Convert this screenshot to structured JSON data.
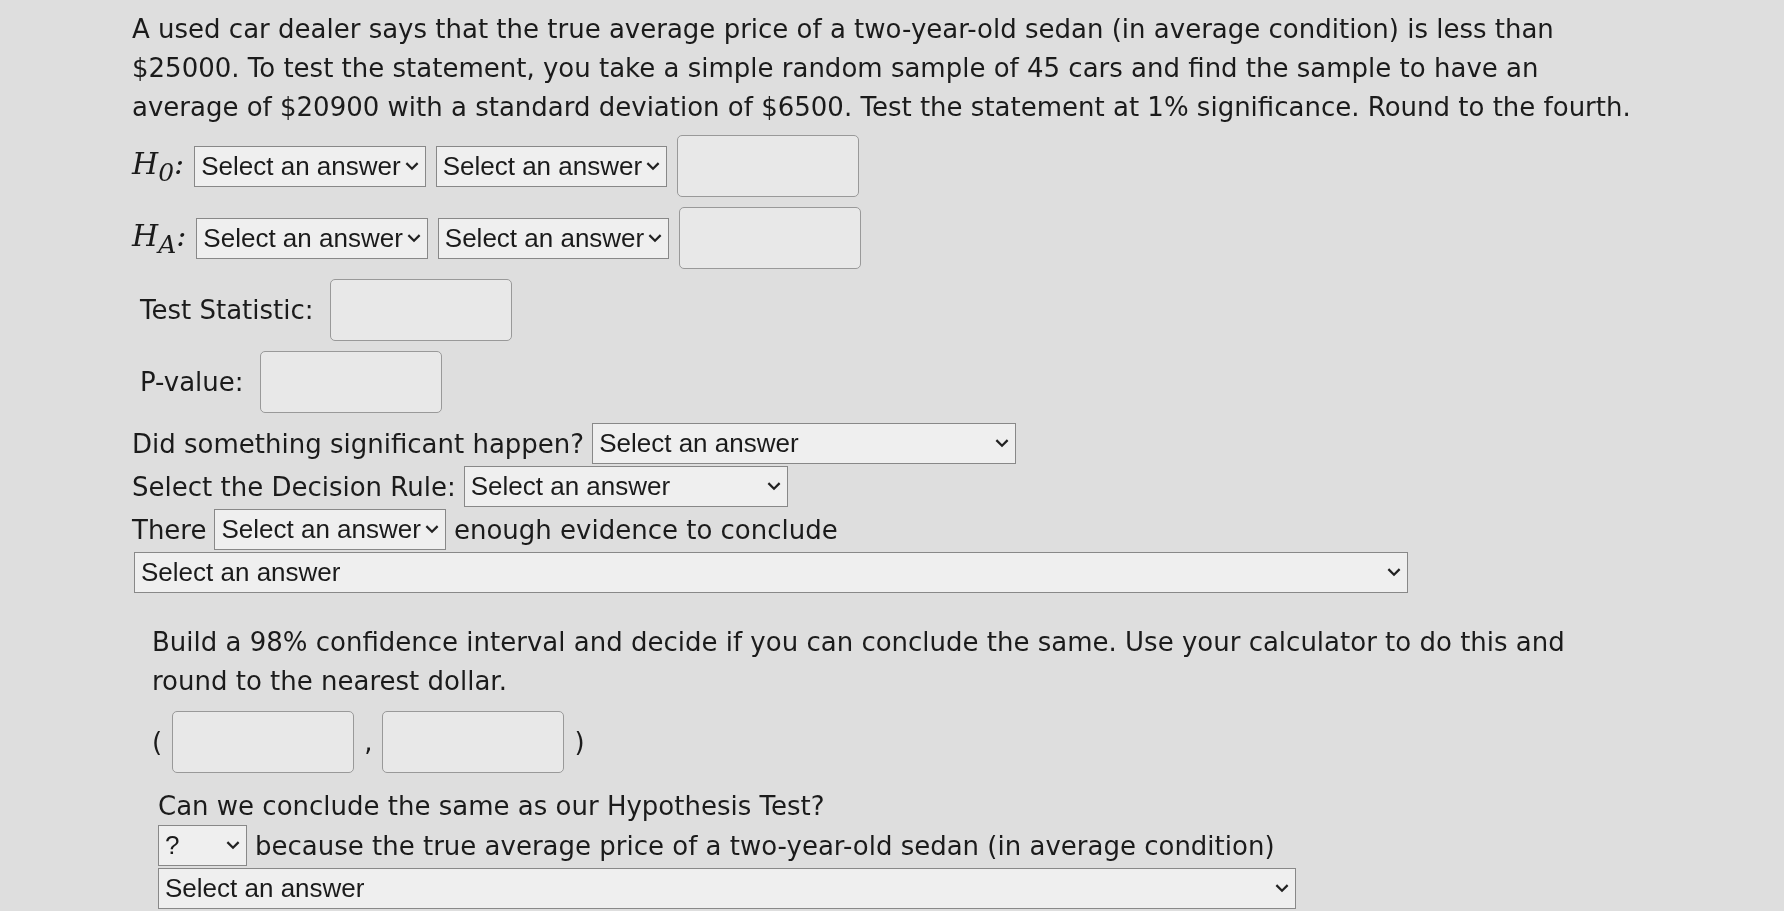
{
  "question": "A used car dealer says that the true average price of a two-year-old sedan (in average condition) is less than $25000. To test the statement, you take a simple random sample of 45 cars and find the sample to have an average of $20900 with a standard deviation of $6500. Test the statement at 1% significance. Round to the fourth.",
  "hypotheses": [
    {
      "label": "H$_{0}$:",
      "selects": [
        "Select an answer",
        "Select an answer"
      ]
    },
    {
      "label": "H$_{A}$:",
      "selects": [
        "Select an answer",
        "Select an answer"
      ]
    }
  ],
  "test_statistic": {
    "label": "Test Statistic:"
  },
  "p_value": {
    "label": "P-value:"
  },
  "significant": {
    "label": "Did something significant happen?",
    "select": "Select an answer"
  },
  "decision_rule": {
    "label": "Select the Decision Rule:",
    "select": "Select an answer"
  },
  "conclusion": {
    "prefix": "There",
    "select": "Select an answer",
    "suffix": "enough evidence to conclude",
    "wide_select": "Select an answer"
  },
  "ci_prompt": "Build a 98% confidence interval and decide if you can conclude the same. Use your calculator to do this and round to the nearest dollar.",
  "interval": {
    "open": "(",
    "comma": ",",
    "close": ")"
  },
  "same_prompt": "Can we conclude the same as our Hypothesis Test?",
  "same": {
    "select": "?",
    "suffix": "because the true average price of a two-year-old sedan (in average condition)",
    "wide_select": "Select an answer"
  }
}
